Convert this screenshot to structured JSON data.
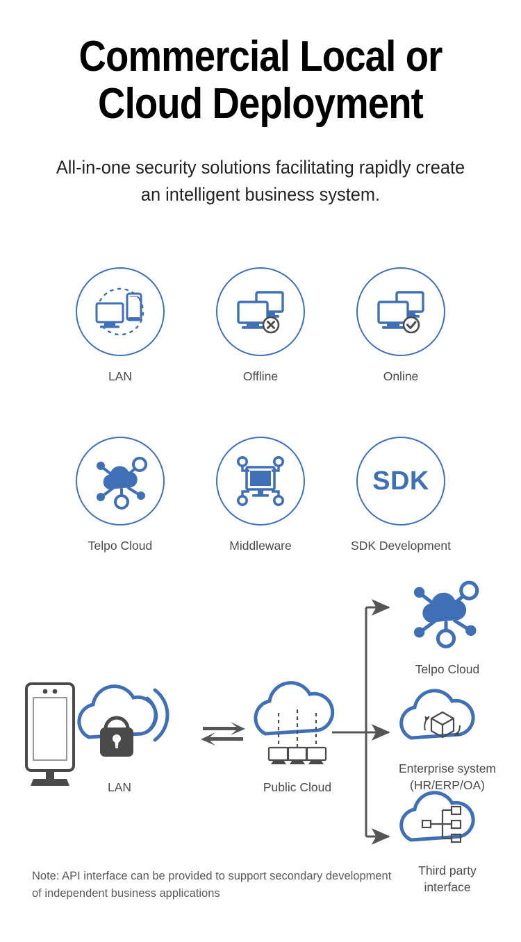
{
  "header": {
    "title_line1": "Commercial Local or",
    "title_line2": "Cloud Deployment",
    "subtitle": "All-in-one security solutions facilitating rapidly create an intelligent business system."
  },
  "colors": {
    "accent_blue": "#3f6fb5",
    "dark_gray": "#4a4a4a",
    "text_black": "#000000",
    "arrow_gray": "#555555"
  },
  "features": {
    "row1": [
      {
        "label": "LAN",
        "icon": "monitor-phone-sync-icon"
      },
      {
        "label": "Offline",
        "icon": "dual-monitor-x-icon"
      },
      {
        "label": "Online",
        "icon": "dual-monitor-check-icon"
      }
    ],
    "row2": [
      {
        "label": "Telpo Cloud",
        "icon": "cloud-network-icon"
      },
      {
        "label": "Middleware",
        "icon": "monitor-nodes-icon"
      },
      {
        "label": "SDK Development",
        "icon": "sdk-text-icon",
        "icon_text": "SDK"
      }
    ]
  },
  "diagram": {
    "nodes": [
      {
        "id": "terminal",
        "label": "",
        "icon": "face-terminal-icon"
      },
      {
        "id": "lan",
        "label": "LAN",
        "icon": "cloud-lock-wifi-icon"
      },
      {
        "id": "public_cloud",
        "label": "Public Cloud",
        "icon": "cloud-monitors-icon"
      },
      {
        "id": "telpo_cloud",
        "label": "Telpo Cloud",
        "icon": "cloud-network-icon"
      },
      {
        "id": "enterprise",
        "label_line1": "Enterprise system",
        "label_line2": "(HR/ERP/OA)",
        "icon": "cloud-box-sync-icon"
      },
      {
        "id": "third_party",
        "label_line1": "Third party",
        "label_line2": "interface",
        "icon": "cloud-tree-icon"
      }
    ],
    "connectors": [
      {
        "id": "lan-publiccloud",
        "type": "bidirectional-arrow"
      },
      {
        "id": "publiccloud-telpo",
        "type": "arrow-up-right"
      },
      {
        "id": "publiccloud-enterprise",
        "type": "arrow-right"
      },
      {
        "id": "publiccloud-thirdparty",
        "type": "arrow-down-right"
      }
    ],
    "note": "Note: API interface can be provided to support secondary development of independent business applications"
  }
}
